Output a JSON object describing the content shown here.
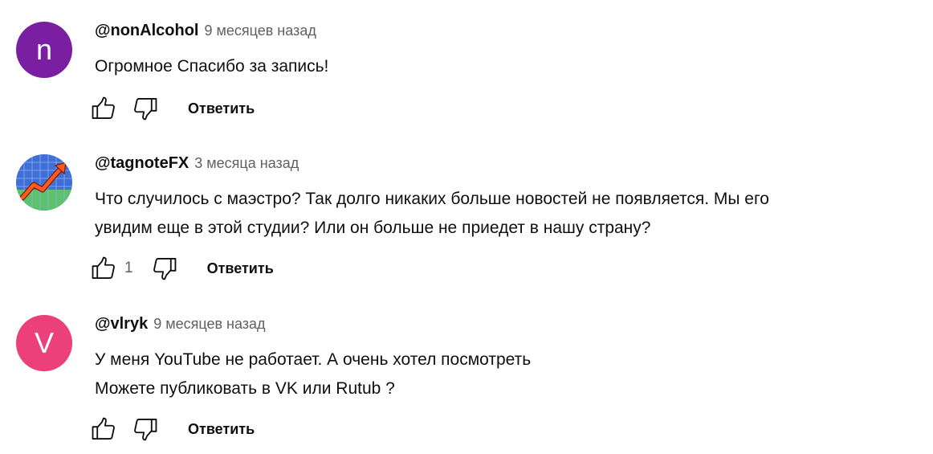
{
  "comments": [
    {
      "author": "@nonAlcohol",
      "time": "9 месяцев назад",
      "avatar_letter": "n",
      "avatar_color": "#7b1fa2",
      "lines": [
        "Огромное Спасибо за запись!"
      ],
      "likes": "",
      "reply_label": "Ответить"
    },
    {
      "author": "@tagnoteFX",
      "time": "3 месяца назад",
      "avatar_icon": "rising-chart-icon",
      "lines": [
        "Что случилось с маэстро? Так долго никаких больше новостей не появляется. Мы его",
        "увидим еще в этой студии? Или он больше не приедет в нашу страну?"
      ],
      "likes": "1",
      "reply_label": "Ответить"
    },
    {
      "author": "@vlryk",
      "time": "9 месяцев назад",
      "avatar_letter": "V",
      "avatar_color": "#ec407a",
      "lines": [
        "У меня YouTube не работает. А  очень хотел посмотреть",
        "Можете публиковать в VK или Rutub ?"
      ],
      "likes": "",
      "reply_label": "Ответить"
    }
  ]
}
